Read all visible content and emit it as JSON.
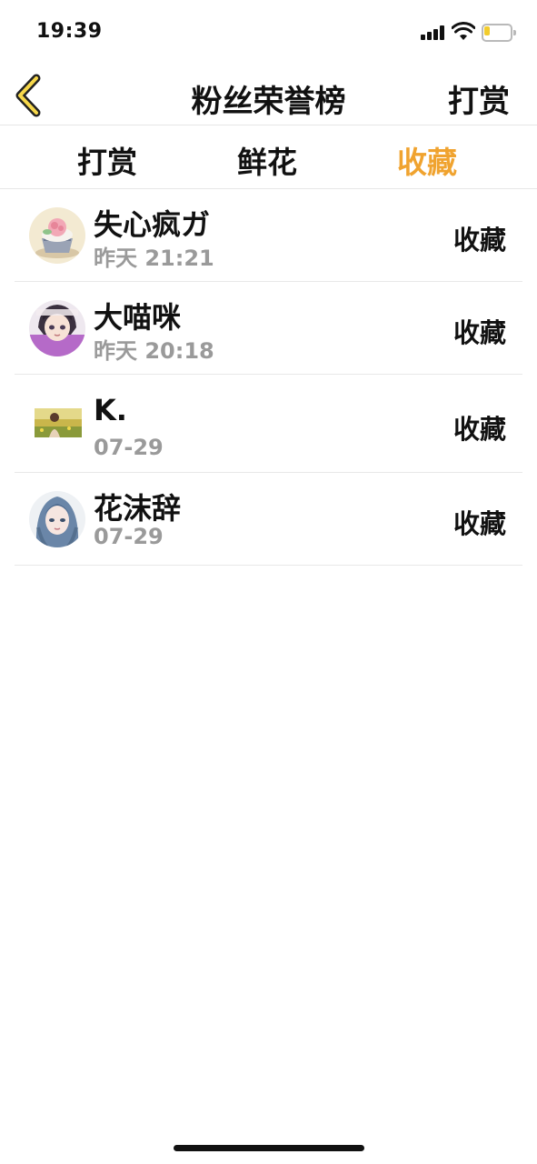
{
  "status_bar": {
    "time": "19:39"
  },
  "nav": {
    "title": "粉丝荣誉榜",
    "right_action": "打赏"
  },
  "tabs": [
    {
      "label": "打赏",
      "active": false
    },
    {
      "label": "鲜花",
      "active": false
    },
    {
      "label": "收藏",
      "active": true
    }
  ],
  "fans": [
    {
      "name": "失心疯ガ",
      "time": "昨天 21:21",
      "action": "收藏",
      "avatar": "cupcake-avatar-icon"
    },
    {
      "name": "大喵咪",
      "time": "昨天 20:18",
      "action": "收藏",
      "avatar": "anime-girl-avatar-icon"
    },
    {
      "name": "K.",
      "time": "07-29",
      "action": "收藏",
      "avatar": "field-photo-avatar-icon"
    },
    {
      "name": "花沫辞",
      "time": "07-29",
      "action": "收藏",
      "avatar": "blue-hair-avatar-icon"
    }
  ],
  "colors": {
    "accent": "#f0a32f",
    "battery": "#f2cc2d",
    "back_arrow_fill": "#f7d84a"
  }
}
